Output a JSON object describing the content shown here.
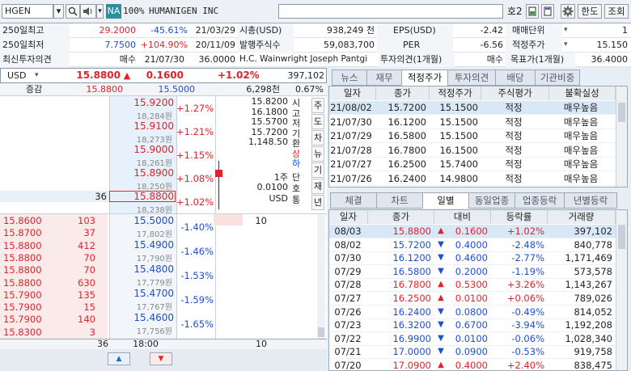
{
  "topbar": {
    "ticker": "HGEN",
    "exchange": "NA",
    "zoom": "100%",
    "company": "HUMANIGEN INC",
    "fav_label": "호2",
    "lang_btn": "한도",
    "query_btn": "조회"
  },
  "summary": {
    "r1": {
      "l1": "250일최고",
      "v1": "29.2000",
      "c1": "-45.61%",
      "d1": "21/03/29",
      "l2": "시총(USD)",
      "v2": "938,249 천",
      "l3": "EPS(USD)",
      "v3": "-2.42",
      "l4": "매매단위",
      "v4": "1"
    },
    "r2": {
      "l1": "250일최저",
      "v1": "7.7500",
      "c1": "+104.90%",
      "d1": "20/11/09",
      "l2": "발행주식수",
      "v2": "59,083,700",
      "l3": "PER",
      "v3": "-6.56",
      "l4": "적정주가",
      "v4": "15.150"
    },
    "r3": {
      "l1": "최신투자의견",
      "v1": "매수",
      "d1": "21/07/30",
      "p1": "36.0000",
      "broker": "H.C. Wainwright Joseph Pantgi",
      "l3": "투자의견(1개월)",
      "v3": "매수",
      "l4": "목표가(1개월)",
      "v4": "36.4000"
    }
  },
  "pricebar": {
    "currency": "USD",
    "price": "15.8800",
    "arrow": "▲",
    "change": "0.1600",
    "pct": "+1.02%",
    "volume": "397,102"
  },
  "subhdr": {
    "label": "증감",
    "bid_top": "15.8800",
    "ask_top": "15.5000",
    "vol": "6,298천",
    "pct": "0.67%"
  },
  "ask_levels": [
    {
      "price": "15.9200",
      "vol": "18,284원",
      "pct": "+1.27%"
    },
    {
      "price": "15.9100",
      "vol": "18,273원",
      "pct": "+1.21%"
    },
    {
      "price": "15.9000",
      "vol": "18,261원",
      "pct": "+1.15%"
    },
    {
      "price": "15.8900",
      "vol": "18,250원",
      "pct": "+1.08%"
    },
    {
      "price": "15.8800",
      "vol": "18,238원",
      "pct": "+1.02%",
      "qty": "36"
    }
  ],
  "bid_levels": [
    {
      "price": "15.5000",
      "vol": "17,802원",
      "pct": "-1.40%",
      "qty": "10"
    },
    {
      "price": "15.4900",
      "vol": "17,790원",
      "pct": "-1.46%"
    },
    {
      "price": "15.4800",
      "vol": "17,779원",
      "pct": "-1.53%"
    },
    {
      "price": "15.4700",
      "vol": "17,767원",
      "pct": "-1.59%"
    },
    {
      "price": "15.4600",
      "vol": "17,756원",
      "pct": "-1.65%"
    }
  ],
  "ohlc": [
    {
      "val": "15.8200",
      "lab": "시"
    },
    {
      "val": "16.1800",
      "lab": "고"
    },
    {
      "val": "15.5700",
      "lab": "저"
    },
    {
      "val": "15.7200",
      "lab": "기"
    },
    {
      "val": "1,148.50",
      "lab": "환"
    },
    {
      "val": "",
      "lab": "상"
    },
    {
      "val": "",
      "lab": "하"
    },
    {
      "val": "1주",
      "lab": "단"
    },
    {
      "val": "0.0100",
      "lab": "호"
    },
    {
      "val": "USD",
      "lab": "통"
    }
  ],
  "side_buttons": [
    "주",
    "도",
    "차",
    "뉴",
    "기",
    "재",
    "년"
  ],
  "trades": [
    {
      "price": "15.8600",
      "qty": "103"
    },
    {
      "price": "15.8700",
      "qty": "37"
    },
    {
      "price": "15.8800",
      "qty": "412"
    },
    {
      "price": "15.8800",
      "qty": "70"
    },
    {
      "price": "15.8800",
      "qty": "70"
    },
    {
      "price": "15.8800",
      "qty": "630"
    },
    {
      "price": "15.7900",
      "qty": "135"
    },
    {
      "price": "15.7900",
      "qty": "15"
    },
    {
      "price": "15.7900",
      "qty": "140"
    },
    {
      "price": "15.8300",
      "qty": "3"
    }
  ],
  "bottom": {
    "left": "36",
    "time": "18:00",
    "right": "10"
  },
  "tabs_top": [
    "뉴스",
    "재무",
    "적정주가",
    "투자의견",
    "배당",
    "기관비중"
  ],
  "fair_header": [
    "일자",
    "종가",
    "적정주가",
    "주식평가",
    "불확실성"
  ],
  "fair_rows": [
    [
      "21/08/02",
      "15.7200",
      "15.1500",
      "적정",
      "매우높음"
    ],
    [
      "21/07/30",
      "16.1200",
      "15.1500",
      "적정",
      "매우높음"
    ],
    [
      "21/07/29",
      "16.5800",
      "15.1500",
      "적정",
      "매우높음"
    ],
    [
      "21/07/28",
      "16.7800",
      "16.1500",
      "적정",
      "매우높음"
    ],
    [
      "21/07/27",
      "16.2500",
      "15.7400",
      "적정",
      "매우높음"
    ],
    [
      "21/07/26",
      "16.2400",
      "14.9800",
      "적정",
      "매우높음"
    ]
  ],
  "tabs_bottom": [
    "체결",
    "차트",
    "일별",
    "동일업종",
    "업종등락",
    "년별등락"
  ],
  "daily_header": [
    "일자",
    "종가",
    "대비",
    "등락률",
    "거래량"
  ],
  "daily_rows": [
    {
      "d": "08/03",
      "p": "15.8800",
      "dir": "up",
      "c": "0.1600",
      "r": "+1.02%",
      "v": "397,102"
    },
    {
      "d": "08/02",
      "p": "15.7200",
      "dir": "down",
      "c": "0.4000",
      "r": "-2.48%",
      "v": "840,778"
    },
    {
      "d": "07/30",
      "p": "16.1200",
      "dir": "down",
      "c": "0.4600",
      "r": "-2.77%",
      "v": "1,171,469"
    },
    {
      "d": "07/29",
      "p": "16.5800",
      "dir": "down",
      "c": "0.2000",
      "r": "-1.19%",
      "v": "573,578"
    },
    {
      "d": "07/28",
      "p": "16.7800",
      "dir": "up",
      "c": "0.5300",
      "r": "+3.26%",
      "v": "1,143,267"
    },
    {
      "d": "07/27",
      "p": "16.2500",
      "dir": "up",
      "c": "0.0100",
      "r": "+0.06%",
      "v": "789,026"
    },
    {
      "d": "07/26",
      "p": "16.2400",
      "dir": "down",
      "c": "0.0800",
      "r": "-0.49%",
      "v": "814,052"
    },
    {
      "d": "07/23",
      "p": "16.3200",
      "dir": "down",
      "c": "0.6700",
      "r": "-3.94%",
      "v": "1,192,208"
    },
    {
      "d": "07/22",
      "p": "16.9900",
      "dir": "down",
      "c": "0.0100",
      "r": "-0.06%",
      "v": "1,028,340"
    },
    {
      "d": "07/21",
      "p": "17.0000",
      "dir": "down",
      "c": "0.0900",
      "r": "-0.53%",
      "v": "919,758"
    },
    {
      "d": "07/20",
      "p": "17.0900",
      "dir": "up",
      "c": "0.4000",
      "r": "+2.40%",
      "v": "838,475"
    }
  ],
  "colors": {
    "up": "#e0232b",
    "down": "#1d4fd1",
    "accent": "#2b6cb0"
  }
}
